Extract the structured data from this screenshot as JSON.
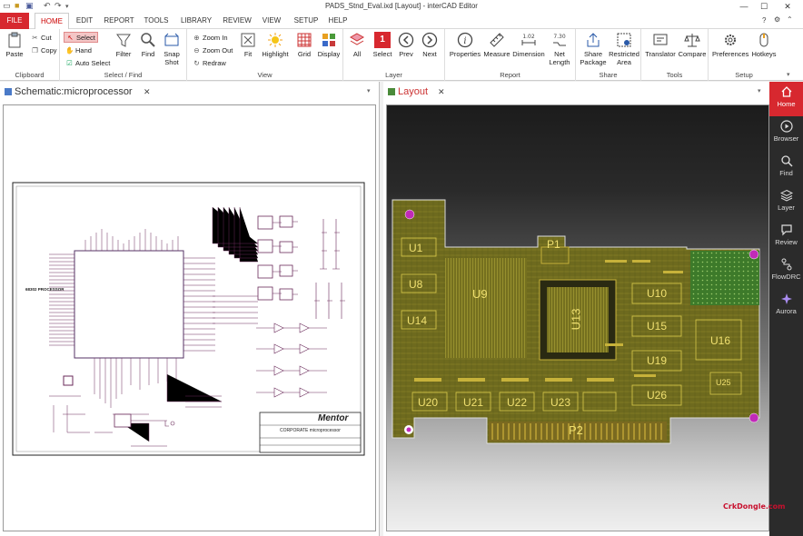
{
  "window": {
    "title": "PADS_Stnd_Eval.ixd [Layout] - interCAD Editor"
  },
  "menu": {
    "file": "FILE",
    "tabs": [
      "HOME",
      "EDIT",
      "REPORT",
      "TOOLS",
      "LIBRARY",
      "REVIEW",
      "VIEW",
      "SETUP",
      "HELP"
    ]
  },
  "ribbon": {
    "clipboard": {
      "label": "Clipboard",
      "paste": "Paste",
      "cut": "Cut",
      "copy": "Copy"
    },
    "select_find": {
      "label": "Select / Find",
      "select": "Select",
      "hand": "Hand",
      "auto_select": "Auto Select",
      "filter": "Filter",
      "find": "Find",
      "snap": "Snap",
      "shot": "Shot"
    },
    "view": {
      "label": "View",
      "zoom_in": "Zoom In",
      "zoom_out": "Zoom Out",
      "redraw": "Redraw",
      "fit": "Fit",
      "highlight": "Highlight",
      "grid": "Grid",
      "display": "Display"
    },
    "layer": {
      "label": "Layer",
      "all": "All",
      "select": "Select",
      "prev": "Prev",
      "next": "Next",
      "badge": "1"
    },
    "report": {
      "label": "Report",
      "properties": "Properties",
      "measure": "Measure",
      "dimension": "Dimension",
      "net": "Net",
      "length": "Length",
      "dim_value": "1.02",
      "net_value": "7.30"
    },
    "share": {
      "label": "Share",
      "share": "Share",
      "package": "Package",
      "restricted": "Restricted",
      "area": "Area"
    },
    "tools": {
      "label": "Tools",
      "translator": "Translator",
      "compare": "Compare"
    },
    "setup": {
      "label": "Setup",
      "preferences": "Preferences",
      "hotkeys": "Hotkeys"
    }
  },
  "panes": {
    "left": {
      "tab": "Schematic:microprocessor"
    },
    "right": {
      "tab": "Layout"
    }
  },
  "schematic": {
    "block_title": "68302 PROCESSOR",
    "logo": "Mentor",
    "company": "CORPORATE",
    "sheet": "microprocessor"
  },
  "pcb": {
    "refs": [
      "U1",
      "U8",
      "U14",
      "U9",
      "U13",
      "P1",
      "U10",
      "U15",
      "U16",
      "U19",
      "U25",
      "U26",
      "U20",
      "U21",
      "U22",
      "U23",
      "P2"
    ]
  },
  "sidebar": {
    "items": [
      "Home",
      "Browser",
      "Find",
      "Layer",
      "Review",
      "FlowDRC",
      "Aurora"
    ]
  },
  "watermark": "CrkDongle.com",
  "colors": {
    "accent": "#d7282f",
    "board": "#6e6a1e",
    "copper": "#c7b23a"
  }
}
